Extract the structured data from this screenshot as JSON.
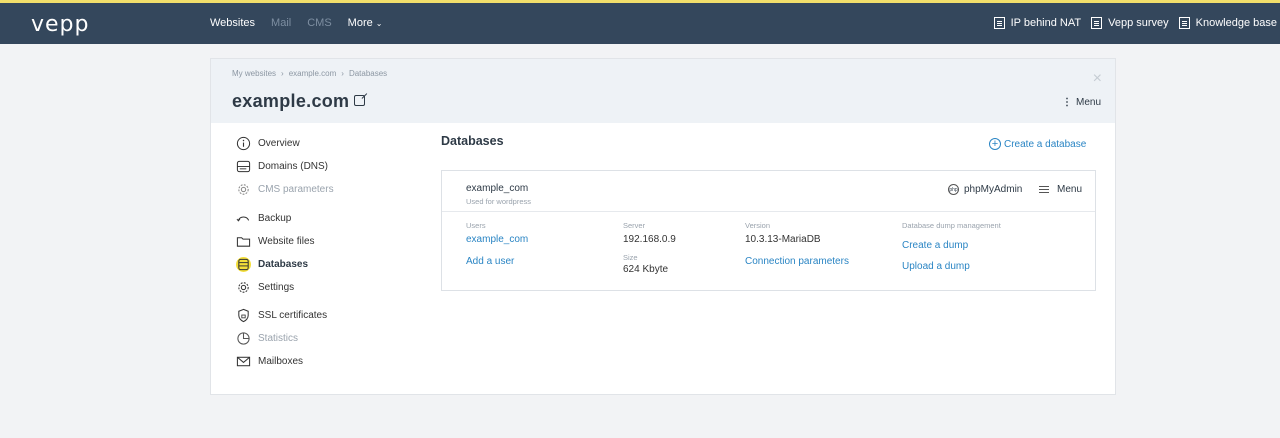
{
  "header": {
    "logo": "vepp",
    "nav": {
      "websites": "Websites",
      "mail": "Mail",
      "cms": "CMS",
      "more": "More",
      "more_arrow": "⌄"
    },
    "right": {
      "ip_nat": "IP behind NAT",
      "survey": "Vepp survey",
      "kb": "Knowledge base"
    }
  },
  "card": {
    "breadcrumb": [
      "My websites",
      "example.com",
      "Databases"
    ],
    "breadcrumb_sep": "›",
    "title": "example.com",
    "close": "×",
    "menu_dots": "⋮",
    "menu": "Menu"
  },
  "sidebar": {
    "items": [
      {
        "label": "Overview",
        "icon": "info-icon"
      },
      {
        "label": "Domains (DNS)",
        "icon": "dns-icon"
      },
      {
        "label": "CMS parameters",
        "icon": "gear-icon"
      },
      {
        "label": "Backup",
        "icon": "backup-icon"
      },
      {
        "label": "Website files",
        "icon": "folder-icon"
      },
      {
        "label": "Databases",
        "icon": "database-icon"
      },
      {
        "label": "Settings",
        "icon": "gear-icon"
      },
      {
        "label": "SSL certificates",
        "icon": "shield-icon"
      },
      {
        "label": "Statistics",
        "icon": "pie-icon"
      },
      {
        "label": "Mailboxes",
        "icon": "mail-icon"
      }
    ]
  },
  "main": {
    "title": "Databases",
    "create": "Create a database",
    "db": {
      "name": "example_com",
      "sub": "Used for wordpress",
      "phpmyadmin": "phpMyAdmin",
      "pma_icon_text": "php",
      "menu": "Menu",
      "users_label": "Users",
      "user": "example_com",
      "add_user": "Add a user",
      "server_label": "Server",
      "server": "192.168.0.9",
      "size_label": "Size",
      "size": "624 Kbyte",
      "version_label": "Version",
      "version": "10.3.13-MariaDB",
      "conn_params": "Connection parameters",
      "dump_label": "Database dump management",
      "create_dump": "Create a dump",
      "upload_dump": "Upload a dump"
    }
  },
  "colors": {
    "topbar": "#34475c",
    "link": "#2a85c4",
    "highlight": "#f4df3a"
  }
}
